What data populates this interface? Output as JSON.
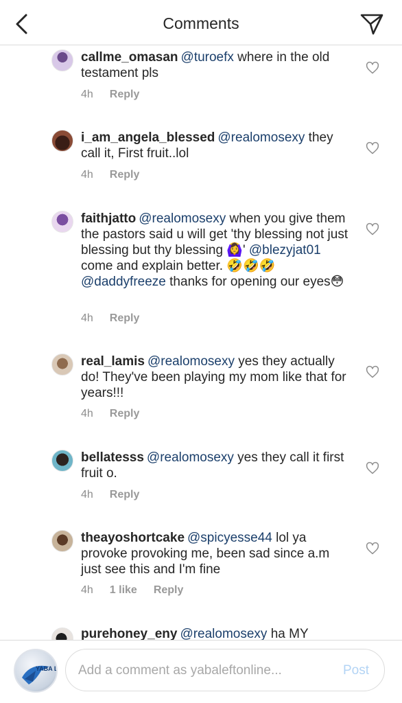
{
  "header": {
    "title": "Comments"
  },
  "comments": [
    {
      "username": "callme_omasan",
      "mention": "@turoefx",
      "text": " where in the old testament pls",
      "time": "4h",
      "likes": "",
      "reply": "Reply"
    },
    {
      "username": "i_am_angela_blessed",
      "mention": "@realomosexy",
      "text": " they call it, First fruit..lol",
      "time": "4h",
      "likes": "",
      "reply": "Reply"
    },
    {
      "username": "faithjatto",
      "mention": "@realomosexy",
      "text_a": " when you give them the pastors said u will get 'thy blessing not just blessing but thy blessing ",
      "emoji_a": "🙆‍♀️",
      "text_b": "' ",
      "mention_b": "@blezyjat01",
      "text_c": " come and explain better. ",
      "emoji_b": "🤣🤣🤣",
      "text_d": " ",
      "mention_c": "@daddyfreeze",
      "text_e": " thanks for opening our eyes",
      "emoji_c": "😳",
      "time": "4h",
      "likes": "",
      "reply": "Reply"
    },
    {
      "username": "real_lamis",
      "mention": "@realomosexy",
      "text": " yes they actually do! They've been playing my mom like that for years!!!",
      "time": "4h",
      "likes": "",
      "reply": "Reply"
    },
    {
      "username": "bellatesss",
      "mention": "@realomosexy",
      "text": " yes they call it first fruit o.",
      "time": "4h",
      "likes": "",
      "reply": "Reply"
    },
    {
      "username": "theayoshortcake",
      "mention": "@spicyesse44",
      "text": " lol ya provoke provoking me, been sad since a.m just see this and I'm fine",
      "time": "4h",
      "likes": "1 like",
      "reply": "Reply"
    },
    {
      "username": "purehoney_eny",
      "mention": "@realomosexy",
      "text": " ha MY",
      "time": "",
      "likes": "",
      "reply": ""
    }
  ],
  "footer": {
    "placeholder": "Add a comment as yabaleftonline...",
    "post_label": "Post",
    "avatar_logo": "YABA LEFT"
  },
  "colors": {
    "mention": "#1b3f6b",
    "meta": "#8e8e8e",
    "post": "#b3d4f5"
  },
  "icons": {
    "back": "chevron-left-icon",
    "send": "paper-plane-icon",
    "like": "heart-outline-icon"
  }
}
